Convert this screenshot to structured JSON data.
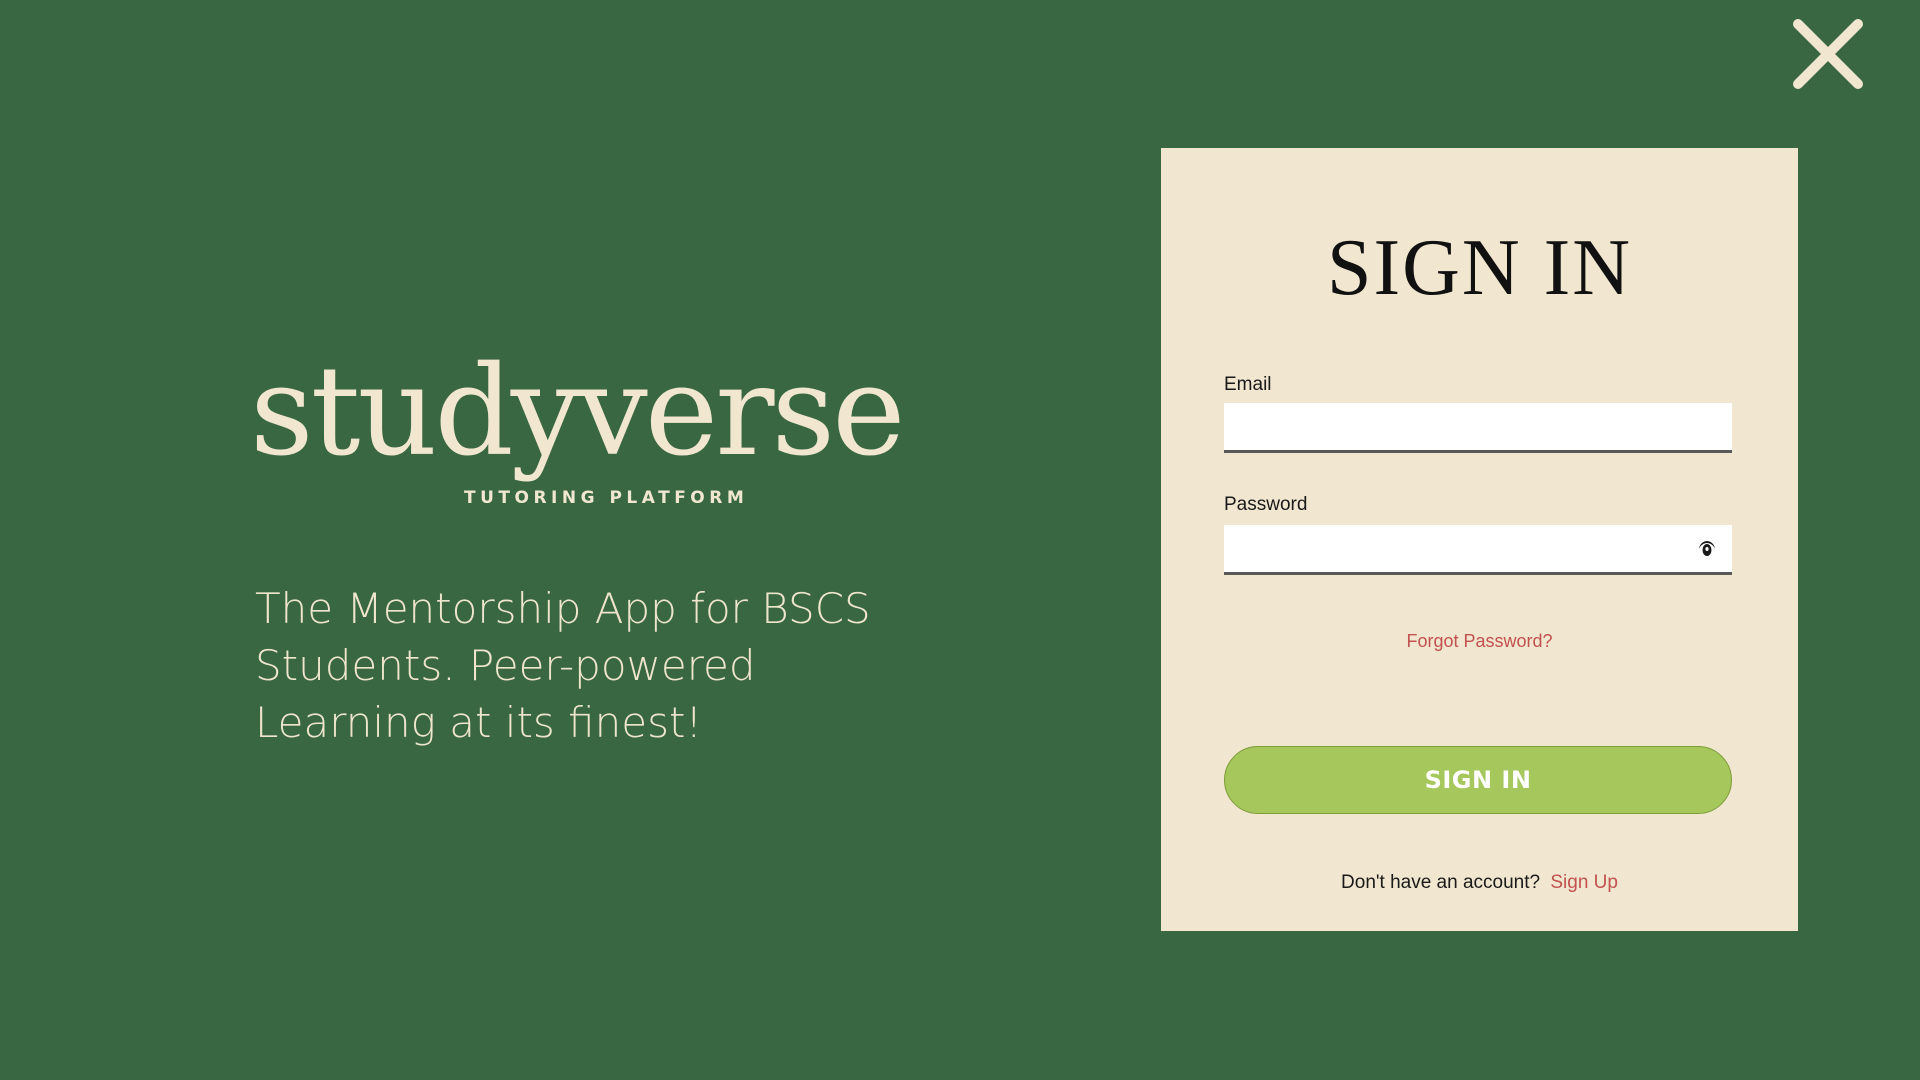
{
  "brand": {
    "name": "studyverse",
    "subtitle": "TUTORING PLATFORM",
    "tagline": "The Mentorship App for BSCS Students. Peer-powered Learning at its finest!"
  },
  "close": {
    "icon": "close-icon"
  },
  "form": {
    "title": "SIGN IN",
    "email_label": "Email",
    "email_value": "",
    "password_label": "Password",
    "password_value": "",
    "password_toggle_icon": "eye-icon",
    "forgot_password": "Forgot Password?",
    "submit_label": "SIGN IN",
    "no_account_text": "Don't have an account?",
    "signup_link": "Sign Up"
  },
  "colors": {
    "background": "#386742",
    "card": "#f1e6cf",
    "button": "#a5c75b",
    "link": "#c2514f",
    "cream_text": "#f1e6cf"
  }
}
